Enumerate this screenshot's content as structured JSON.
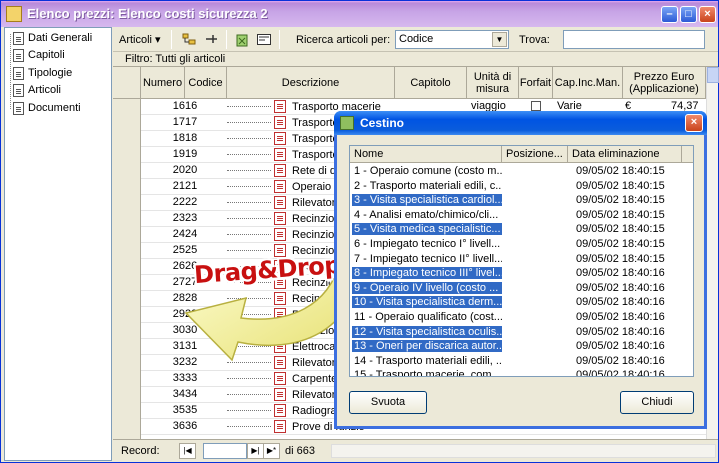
{
  "window": {
    "title": "Elenco prezzi: Elenco costi sicurezza 2"
  },
  "nav": {
    "items": [
      "Dati Generali",
      "Capitoli",
      "Tipologie",
      "Articoli",
      "Documenti"
    ]
  },
  "toolbar": {
    "articoli_menu": "Articoli ▾",
    "search_label": "Ricerca articoli per:",
    "search_value": "Codice",
    "find_label": "Trova:",
    "find_value": ""
  },
  "filter": {
    "text": "Filtro:  Tutti gli articoli"
  },
  "grid": {
    "headers": {
      "numero": "Numero",
      "codice": "Codice",
      "descrizione": "Descrizione",
      "capitolo": "Capitolo",
      "unita": "Unità di misura",
      "forfait": "Forfait",
      "capinc": "Cap.Inc.Man.",
      "prezzo": "Prezzo Euro (Applicazione)"
    },
    "first_row": {
      "unita": "viaggio",
      "capinc": "Varie",
      "euro": "€",
      "prezzo": "74,37"
    },
    "rows": [
      {
        "num": "16",
        "cod": "16",
        "desc": "Trasporto macerie"
      },
      {
        "num": "17",
        "cod": "17",
        "desc": "Trasporto macer"
      },
      {
        "num": "18",
        "cod": "18",
        "desc": "Trasporto di ma"
      },
      {
        "num": "19",
        "cod": "19",
        "desc": "Trasporto di ma"
      },
      {
        "num": "20",
        "cod": "20",
        "desc": "Rete di distribu"
      },
      {
        "num": "21",
        "cod": "21",
        "desc": "Operaio special"
      },
      {
        "num": "22",
        "cod": "22",
        "desc": "Rilevatore di ga"
      },
      {
        "num": "23",
        "cod": "23",
        "desc": "Recinzione di c"
      },
      {
        "num": "24",
        "cod": "24",
        "desc": "Recinzione di c"
      },
      {
        "num": "25",
        "cod": "25",
        "desc": "Recinzione di c"
      },
      {
        "num": "26",
        "cod": "26",
        "desc": "Recinzione di c"
      },
      {
        "num": "27",
        "cod": "27",
        "desc": "Recinzione di c"
      },
      {
        "num": "28",
        "cod": "28",
        "desc": "Recinzione di c"
      },
      {
        "num": "29",
        "cod": "29",
        "desc": "Recinzione di c"
      },
      {
        "num": "30",
        "cod": "30",
        "desc": "Recinzione di c"
      },
      {
        "num": "31",
        "cod": "31",
        "desc": "Elettrocardiogra"
      },
      {
        "num": "32",
        "cod": "32",
        "desc": "Rilevatore della"
      },
      {
        "num": "33",
        "cod": "33",
        "desc": "Carpenteria me"
      },
      {
        "num": "34",
        "cod": "34",
        "desc": "Rilevatore port"
      },
      {
        "num": "35",
        "cod": "35",
        "desc": "Radiografia tor"
      },
      {
        "num": "36",
        "cod": "36",
        "desc": "Prove di funzio"
      }
    ]
  },
  "recordbar": {
    "label": "Record:",
    "current": "",
    "total": "di 663"
  },
  "dialog": {
    "title": "Cestino",
    "columns": [
      "Nome",
      "Posizione...",
      "Data eliminazione"
    ],
    "rows": [
      {
        "name": "1 - Operaio comune (costo m...",
        "date": "09/05/02 18:40:15",
        "selected": false
      },
      {
        "name": "2 - Trasporto materiali edili, c...",
        "date": "09/05/02 18:40:15",
        "selected": false
      },
      {
        "name": "3 - Visita specialistica cardiol...",
        "date": "09/05/02 18:40:15",
        "selected": true
      },
      {
        "name": "4 - Analisi emato/chimico/cli...",
        "date": "09/05/02 18:40:15",
        "selected": false
      },
      {
        "name": "5 - Visita medica specialistic...",
        "date": "09/05/02 18:40:15",
        "selected": true
      },
      {
        "name": "6 - Impiegato tecnico I° livell...",
        "date": "09/05/02 18:40:15",
        "selected": false
      },
      {
        "name": "7 - Impiegato tecnico II° livell...",
        "date": "09/05/02 18:40:15",
        "selected": false
      },
      {
        "name": "8 - Impiegato tecnico III° livel...",
        "date": "09/05/02 18:40:16",
        "selected": true
      },
      {
        "name": "9 - Operaio IV livello (costo ...",
        "date": "09/05/02 18:40:16",
        "selected": true
      },
      {
        "name": "10 - Visita specialistica derm...",
        "date": "09/05/02 18:40:16",
        "selected": true
      },
      {
        "name": "11 - Operaio qualificato (cost...",
        "date": "09/05/02 18:40:16",
        "selected": false
      },
      {
        "name": "12 - Visita specialistica oculis...",
        "date": "09/05/02 18:40:16",
        "selected": true
      },
      {
        "name": "13 - Oneri per discarica autor...",
        "date": "09/05/02 18:40:16",
        "selected": true
      },
      {
        "name": "14 - Trasporto materiali edili, ...",
        "date": "09/05/02 18:40:16",
        "selected": false
      },
      {
        "name": "15 - Trasporto macerie, com...",
        "date": "09/05/02 18:40:16",
        "selected": false
      }
    ],
    "empty_button": "Svuota",
    "close_button": "Chiudi"
  },
  "overlay": {
    "text": "Drag&Drop"
  }
}
